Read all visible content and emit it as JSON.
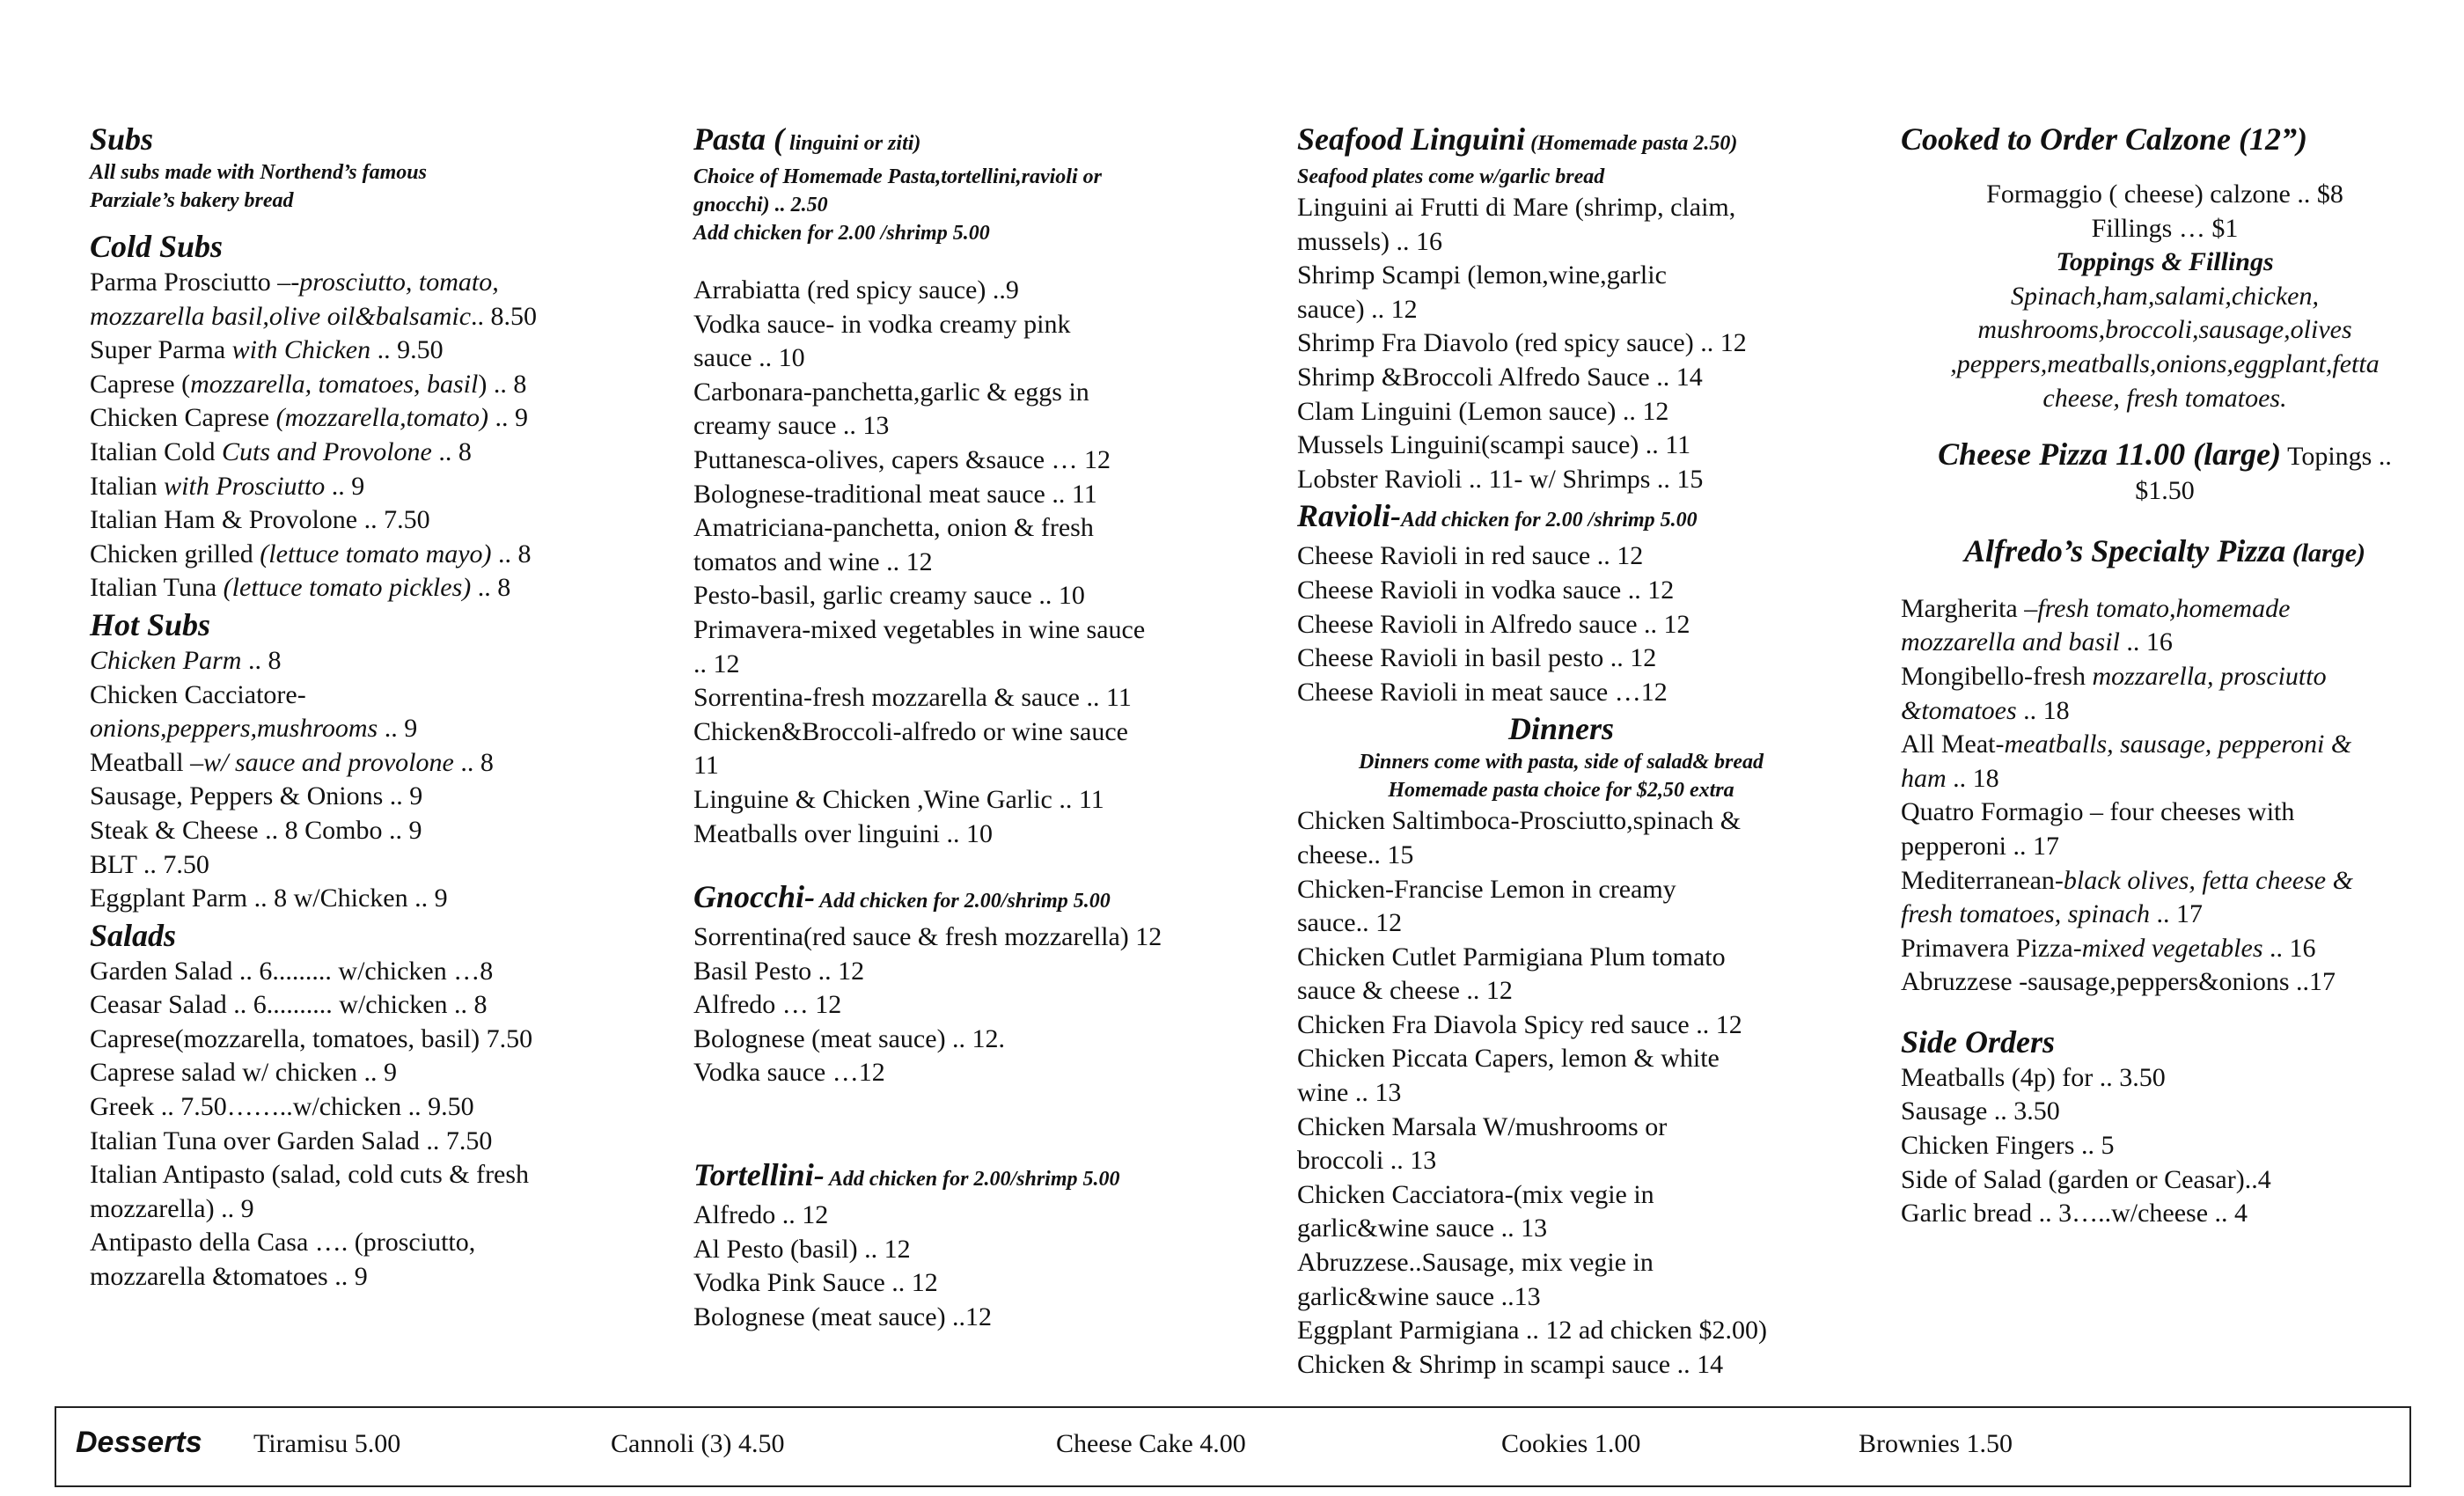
{
  "subs": {
    "title": "Subs",
    "note1": "All subs made with   Northend’s famous",
    "note2": "Parziale’s bakery bread",
    "cold_title": "Cold Subs",
    "cold": [
      [
        "Parma Prosciutto –",
        "-prosciutto, tomato,",
        ""
      ],
      [
        "",
        "mozzarella basil,olive oil&balsamic",
        ".. 8.50"
      ],
      [
        "Super Parma ",
        "with Chicken",
        " .. 9.50"
      ],
      [
        "Caprese (",
        "mozzarella, tomatoes, basil",
        ") .. 8"
      ],
      [
        "Chicken Caprese ",
        "(mozzarella,tomato)",
        " .. 9"
      ],
      [
        "Italian Cold ",
        "Cuts and Provolone",
        " .. 8"
      ],
      [
        "Italian ",
        "with Prosciutto",
        " .. 9"
      ],
      [
        "Italian Ham & Provolone .. 7.50",
        "",
        ""
      ],
      [
        "Chicken grilled ",
        "(lettuce tomato mayo)",
        " .. 8"
      ],
      [
        "Italian Tuna ",
        "(lettuce tomato pickles)",
        " .. 8"
      ]
    ],
    "hot_title": "Hot Subs",
    "hot": [
      [
        "",
        "Chicken Parm",
        " .. 8"
      ],
      [
        "Chicken Cacciatore-",
        "",
        ""
      ],
      [
        "",
        "onions,peppers,mushrooms",
        " .. 9"
      ],
      [
        "Meatball ",
        "–w/ sauce and provolone",
        " .. 8"
      ],
      [
        "Sausage, Peppers & Onions .. 9",
        "",
        ""
      ],
      [
        "Steak & Cheese .. 8    Combo .. 9",
        "",
        ""
      ],
      [
        "BLT .. 7.50",
        "",
        ""
      ],
      [
        "Eggplant Parm   .. 8      w/Chicken .. 9",
        "",
        ""
      ]
    ],
    "salads_title": "Salads",
    "salads": [
      "Garden Salad  .. 6......... w/chicken …8",
      "Ceasar Salad  .. 6.......... w/chicken .. 8",
      "Caprese(mozzarella, tomatoes, basil) 7.50",
      "Caprese salad w/ chicken .. 9",
      "Greek  .. 7.50……..w/chicken  .. 9.50",
      "Italian Tuna over Garden Salad  .. 7.50",
      "Italian Antipasto (salad, cold cuts & fresh",
      "mozzarella) .. 9",
      "Antipasto della Casa …. (prosciutto,",
      "mozzarella &tomatoes .. 9"
    ]
  },
  "pasta": {
    "title": "Pasta (",
    "title_small": " linguini or ziti)",
    "notes": [
      "Choice of Homemade Pasta,tortellini,ravioli or",
      "gnocchi)  .. 2.50",
      "Add chicken  for 2.00 /shrimp 5.00"
    ],
    "items": [
      "Arrabiatta (red spicy sauce) ..9",
      "Vodka sauce- in vodka creamy pink",
      "sauce      .. 10",
      "Carbonara-panchetta,garlic & eggs in",
      "creamy sauce  .. 13",
      "Puttanesca-olives, capers &sauce … 12",
      "Bolognese-traditional meat sauce .. 11",
      "Amatriciana-panchetta, onion & fresh",
      "tomatos  and wine .. 12",
      "Pesto-basil, garlic creamy sauce .. 10",
      "Primavera-mixed vegetables in wine sauce",
      ".. 12",
      "Sorrentina-fresh mozzarella & sauce .. 11",
      "Chicken&Broccoli-alfredo or wine sauce",
      "11",
      "Linguine & Chicken ,Wine Garlic .. 11",
      "Meatballs over linguini .. 10"
    ],
    "gnocchi_title": " Gnocchi-",
    "gnocchi_note": " Add chicken for 2.00/shrimp 5.00",
    "gnocchi": [
      "Sorrentina(red sauce & fresh mozzarella) 12",
      "Basil Pesto .. 12",
      "Alfredo … 12",
      "Bolognese (meat sauce) .. 12.",
      "Vodka sauce …12"
    ],
    "tortellini_title": "Tortellini-",
    "tortellini_note": " Add chicken for 2.00/shrimp 5.00",
    "tortellini": [
      "Alfredo .. 12",
      "Al Pesto (basil) .. 12",
      "Vodka Pink Sauce .. 12",
      "Bolognese (meat sauce) ..12"
    ]
  },
  "seafood": {
    "title": "Seafood Linguini",
    "title_small": " (Homemade pasta 2.50)",
    "note": "Seafood plates come w/garlic bread",
    "items": [
      "Linguini ai Frutti di Mare (shrimp, claim,",
      "mussels) .. 16",
      "Shrimp Scampi (lemon,wine,garlic",
      "sauce) .. 12",
      "Shrimp Fra Diavolo (red spicy sauce) .. 12",
      "Shrimp &Broccoli Alfredo Sauce .. 14",
      "Clam Linguini (Lemon sauce) .. 12",
      "Mussels Linguini(scampi sauce) .. 11",
      "Lobster Ravioli .. 11- w/ Shrimps .. 15"
    ],
    "ravioli_title": "Ravioli-",
    "ravioli_note": "Add chicken for 2.00 /shrimp 5.00",
    "ravioli": [
      "Cheese Ravioli in red sauce .. 12",
      "Cheese Ravioli in vodka sauce .. 12",
      "Cheese Ravioli in Alfredo sauce .. 12",
      "Cheese Ravioli in basil pesto  .. 12",
      "Cheese Ravioli in meat sauce …12"
    ],
    "dinners_title": "Dinners",
    "dinners_notes": [
      "Dinners come with pasta, side of salad& bread",
      "Homemade pasta choice for $2,50 extra"
    ],
    "dinners": [
      "Chicken Saltimboca-Prosciutto,spinach &",
      "cheese.. 15",
      "Chicken-Francise Lemon in creamy",
      "sauce.. 12",
      "Chicken Cutlet Parmigiana Plum tomato",
      "sauce & cheese .. 12",
      "Chicken Fra Diavola Spicy red sauce .. 12",
      "Chicken Piccata Capers, lemon & white",
      "wine .. 13",
      "Chicken Marsala W/mushrooms or",
      "broccoli .. 13",
      "Chicken Cacciatora-(mix vegie in",
      "garlic&wine sauce .. 13",
      "Abruzzese..Sausage, mix vegie in",
      "garlic&wine sauce ..13",
      "Eggplant Parmigiana .. 12 ad chicken $2.00)",
      "Chicken & Shrimp in scampi sauce .. 14"
    ]
  },
  "calzone": {
    "title": "Cooked to Order Calzone (12”)",
    "lines": [
      "Formaggio  ( cheese)  calzone .. $8",
      "Fillings … $1"
    ],
    "toppings_title": "Toppings & Fillings",
    "toppings": [
      "Spinach,ham,salami,chicken,",
      "mushrooms,broccoli,sausage,olives",
      ",peppers,meatballs,onions,eggplant,fetta",
      "cheese, fresh tomatoes."
    ],
    "pizza_title": "Cheese Pizza 11.00 (large)",
    "pizza_rest": " Topings ..",
    "pizza_rest2": "$1.50",
    "specialty_title": "Alfredo’s Specialty Pizza",
    "specialty_small": " (large)",
    "specialty": [
      [
        "Margherita ",
        "–fresh tomato,homemade",
        ""
      ],
      [
        "",
        "mozzarella and basil",
        " .. 16"
      ],
      [
        "Mongibello-fresh ",
        "mozzarella, prosciutto",
        ""
      ],
      [
        "",
        "&tomatoes",
        " .. 18"
      ],
      [
        "All Meat-",
        "meatballs, sausage, pepperoni &",
        ""
      ],
      [
        "",
        "ham",
        "    .. 18"
      ],
      [
        "Quatro Formagio – four cheeses with",
        "",
        ""
      ],
      [
        "pepperoni .. 17",
        "",
        ""
      ],
      [
        "Mediterranean-",
        "black olives, fetta cheese &",
        ""
      ],
      [
        "",
        "fresh tomatoes, spinach",
        " .. 17"
      ],
      [
        "Primavera Pizza-",
        "mixed vegetables",
        " .. 16"
      ],
      [
        "Abruzzese -sausage,peppers&onions ..17",
        "",
        ""
      ]
    ],
    "side_title": "Side Orders",
    "sides": [
      "Meatballs (4p) for .. 3.50",
      "Sausage .. 3.50",
      "Chicken Fingers .. 5",
      "Side of Salad (garden or Ceasar)..4",
      "Garlic bread .. 3…..w/cheese .. 4"
    ]
  },
  "desserts": {
    "title": "Desserts",
    "items": [
      "Tiramisu 5.00",
      "Cannoli (3) 4.50",
      "Cheese Cake 4.00",
      "Cookies 1.00",
      "Brownies 1.50"
    ]
  }
}
